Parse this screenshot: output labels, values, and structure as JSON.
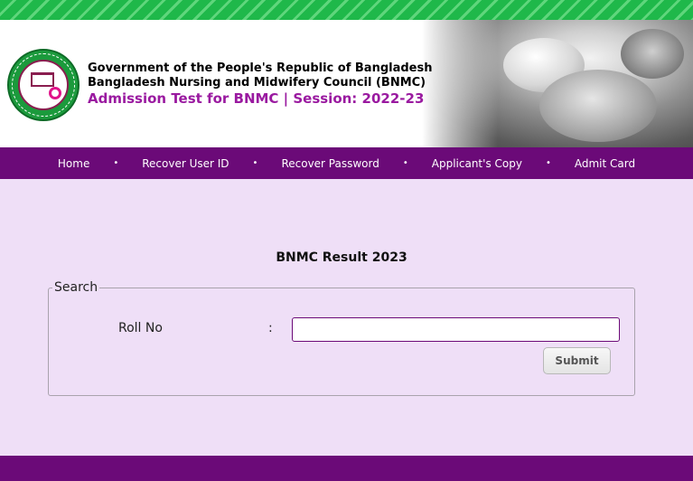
{
  "header": {
    "line1": "Government of the People's Republic of Bangladesh",
    "line2": "Bangladesh Nursing and Midwifery Council (BNMC)",
    "line3": "Admission Test for BNMC | Session: 2022-23"
  },
  "nav": {
    "items": [
      "Home",
      "Recover User ID",
      "Recover Password",
      "Applicant's Copy",
      "Admit Card"
    ],
    "separator": "•"
  },
  "main": {
    "title": "BNMC Result 2023",
    "search": {
      "legend": "Search",
      "roll_label": "Roll No",
      "colon": ":",
      "roll_value": "",
      "submit_label": "Submit"
    }
  },
  "colors": {
    "accent": "#6b0a78",
    "stripe": "#1fb84a",
    "background": "#efdff7",
    "session_text": "#9a1aa0"
  }
}
